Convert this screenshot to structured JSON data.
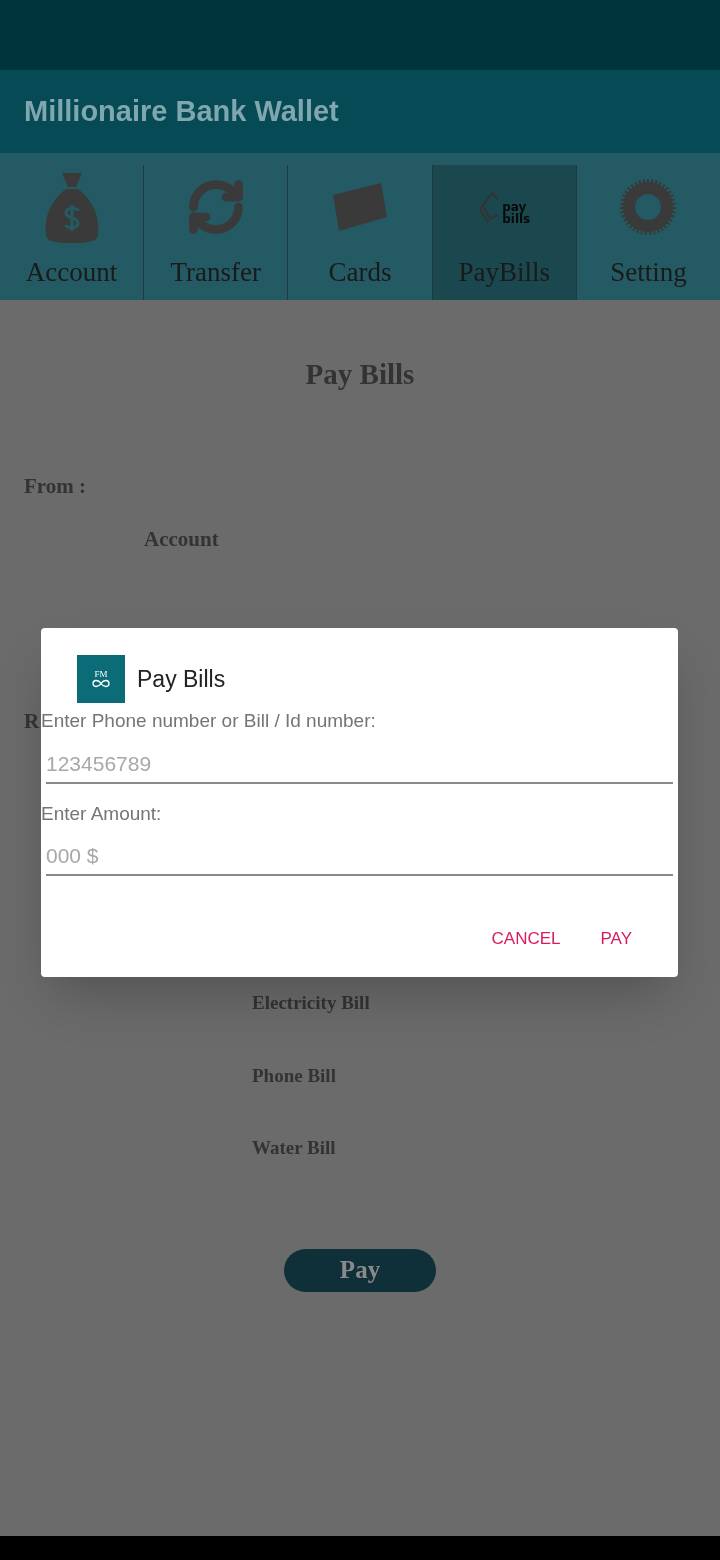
{
  "app_bar": {
    "title": "Millionaire Bank Wallet"
  },
  "tabs": [
    {
      "label": "Account",
      "kind": "bag",
      "selected": false
    },
    {
      "label": "Transfer",
      "kind": "sync",
      "selected": false
    },
    {
      "label": "Cards",
      "kind": "card",
      "selected": false
    },
    {
      "label": "PayBills",
      "kind": "paybills",
      "icon_text": [
        "pay",
        "bills"
      ],
      "selected": true
    },
    {
      "label": "Setting",
      "kind": "gear",
      "selected": false
    }
  ],
  "page": {
    "title": "Pay Bills",
    "from_label": "From :",
    "from_value": "Account",
    "partial_label": "R",
    "bill_options": [
      "Electricity Bill",
      "Phone Bill",
      "Water Bill"
    ],
    "pay_button": "Pay"
  },
  "dialog": {
    "logo_text": "FM",
    "title": "Pay Bills",
    "fields": [
      {
        "label": "Enter Phone number or Bill / Id number:",
        "placeholder": "123456789"
      },
      {
        "label": "Enter Amount:",
        "placeholder": "000 $"
      }
    ],
    "buttons": [
      "CANCEL",
      "PAY"
    ]
  }
}
